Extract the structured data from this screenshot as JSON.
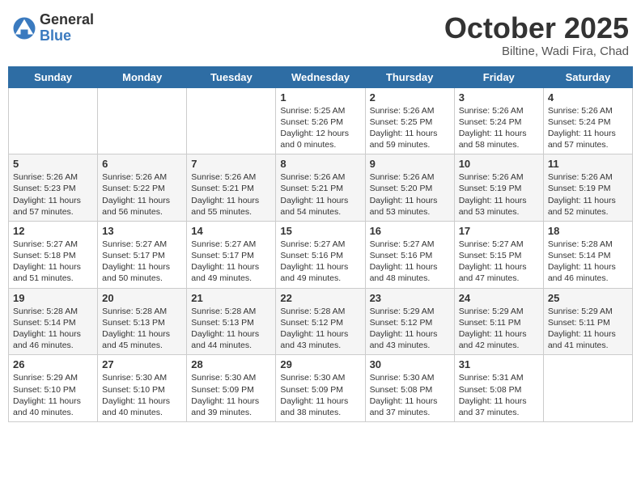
{
  "header": {
    "logo_general": "General",
    "logo_blue": "Blue",
    "month_title": "October 2025",
    "location": "Biltine, Wadi Fira, Chad"
  },
  "days_of_week": [
    "Sunday",
    "Monday",
    "Tuesday",
    "Wednesday",
    "Thursday",
    "Friday",
    "Saturday"
  ],
  "weeks": [
    {
      "days": [
        {
          "number": "",
          "info": ""
        },
        {
          "number": "",
          "info": ""
        },
        {
          "number": "",
          "info": ""
        },
        {
          "number": "1",
          "info": "Sunrise: 5:25 AM\nSunset: 5:26 PM\nDaylight: 12 hours\nand 0 minutes."
        },
        {
          "number": "2",
          "info": "Sunrise: 5:26 AM\nSunset: 5:25 PM\nDaylight: 11 hours\nand 59 minutes."
        },
        {
          "number": "3",
          "info": "Sunrise: 5:26 AM\nSunset: 5:24 PM\nDaylight: 11 hours\nand 58 minutes."
        },
        {
          "number": "4",
          "info": "Sunrise: 5:26 AM\nSunset: 5:24 PM\nDaylight: 11 hours\nand 57 minutes."
        }
      ]
    },
    {
      "days": [
        {
          "number": "5",
          "info": "Sunrise: 5:26 AM\nSunset: 5:23 PM\nDaylight: 11 hours\nand 57 minutes."
        },
        {
          "number": "6",
          "info": "Sunrise: 5:26 AM\nSunset: 5:22 PM\nDaylight: 11 hours\nand 56 minutes."
        },
        {
          "number": "7",
          "info": "Sunrise: 5:26 AM\nSunset: 5:21 PM\nDaylight: 11 hours\nand 55 minutes."
        },
        {
          "number": "8",
          "info": "Sunrise: 5:26 AM\nSunset: 5:21 PM\nDaylight: 11 hours\nand 54 minutes."
        },
        {
          "number": "9",
          "info": "Sunrise: 5:26 AM\nSunset: 5:20 PM\nDaylight: 11 hours\nand 53 minutes."
        },
        {
          "number": "10",
          "info": "Sunrise: 5:26 AM\nSunset: 5:19 PM\nDaylight: 11 hours\nand 53 minutes."
        },
        {
          "number": "11",
          "info": "Sunrise: 5:26 AM\nSunset: 5:19 PM\nDaylight: 11 hours\nand 52 minutes."
        }
      ]
    },
    {
      "days": [
        {
          "number": "12",
          "info": "Sunrise: 5:27 AM\nSunset: 5:18 PM\nDaylight: 11 hours\nand 51 minutes."
        },
        {
          "number": "13",
          "info": "Sunrise: 5:27 AM\nSunset: 5:17 PM\nDaylight: 11 hours\nand 50 minutes."
        },
        {
          "number": "14",
          "info": "Sunrise: 5:27 AM\nSunset: 5:17 PM\nDaylight: 11 hours\nand 49 minutes."
        },
        {
          "number": "15",
          "info": "Sunrise: 5:27 AM\nSunset: 5:16 PM\nDaylight: 11 hours\nand 49 minutes."
        },
        {
          "number": "16",
          "info": "Sunrise: 5:27 AM\nSunset: 5:16 PM\nDaylight: 11 hours\nand 48 minutes."
        },
        {
          "number": "17",
          "info": "Sunrise: 5:27 AM\nSunset: 5:15 PM\nDaylight: 11 hours\nand 47 minutes."
        },
        {
          "number": "18",
          "info": "Sunrise: 5:28 AM\nSunset: 5:14 PM\nDaylight: 11 hours\nand 46 minutes."
        }
      ]
    },
    {
      "days": [
        {
          "number": "19",
          "info": "Sunrise: 5:28 AM\nSunset: 5:14 PM\nDaylight: 11 hours\nand 46 minutes."
        },
        {
          "number": "20",
          "info": "Sunrise: 5:28 AM\nSunset: 5:13 PM\nDaylight: 11 hours\nand 45 minutes."
        },
        {
          "number": "21",
          "info": "Sunrise: 5:28 AM\nSunset: 5:13 PM\nDaylight: 11 hours\nand 44 minutes."
        },
        {
          "number": "22",
          "info": "Sunrise: 5:28 AM\nSunset: 5:12 PM\nDaylight: 11 hours\nand 43 minutes."
        },
        {
          "number": "23",
          "info": "Sunrise: 5:29 AM\nSunset: 5:12 PM\nDaylight: 11 hours\nand 43 minutes."
        },
        {
          "number": "24",
          "info": "Sunrise: 5:29 AM\nSunset: 5:11 PM\nDaylight: 11 hours\nand 42 minutes."
        },
        {
          "number": "25",
          "info": "Sunrise: 5:29 AM\nSunset: 5:11 PM\nDaylight: 11 hours\nand 41 minutes."
        }
      ]
    },
    {
      "days": [
        {
          "number": "26",
          "info": "Sunrise: 5:29 AM\nSunset: 5:10 PM\nDaylight: 11 hours\nand 40 minutes."
        },
        {
          "number": "27",
          "info": "Sunrise: 5:30 AM\nSunset: 5:10 PM\nDaylight: 11 hours\nand 40 minutes."
        },
        {
          "number": "28",
          "info": "Sunrise: 5:30 AM\nSunset: 5:09 PM\nDaylight: 11 hours\nand 39 minutes."
        },
        {
          "number": "29",
          "info": "Sunrise: 5:30 AM\nSunset: 5:09 PM\nDaylight: 11 hours\nand 38 minutes."
        },
        {
          "number": "30",
          "info": "Sunrise: 5:30 AM\nSunset: 5:08 PM\nDaylight: 11 hours\nand 37 minutes."
        },
        {
          "number": "31",
          "info": "Sunrise: 5:31 AM\nSunset: 5:08 PM\nDaylight: 11 hours\nand 37 minutes."
        },
        {
          "number": "",
          "info": ""
        }
      ]
    }
  ]
}
